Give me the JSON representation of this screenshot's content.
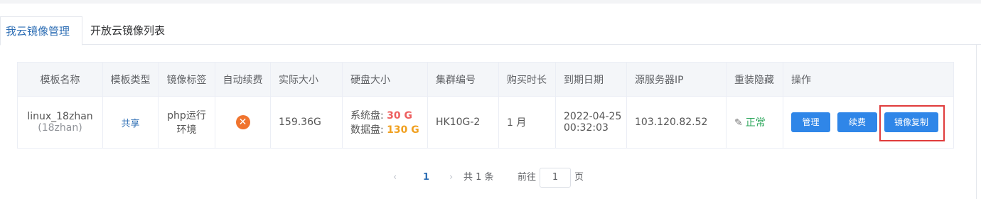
{
  "tabs": [
    {
      "label": "我云镜像管理",
      "active": true
    },
    {
      "label": "开放云镜像列表",
      "active": false
    }
  ],
  "table": {
    "headers": [
      "模板名称",
      "模板类型",
      "镜像标签",
      "自动续费",
      "实际大小",
      "硬盘大小",
      "集群编号",
      "购买时长",
      "到期日期",
      "源服务器IP",
      "重装隐藏",
      "操作"
    ],
    "row": {
      "name": "linux_18zhan",
      "name_sub": "(18zhan)",
      "type": "共享",
      "tag_line1": "php运行",
      "tag_line2": "环境",
      "auto_renew_icon": "x-icon",
      "actual_size": "159.36G",
      "sys_disk_label": "系统盘:",
      "sys_disk_value": "30 G",
      "data_disk_label": "数据盘:",
      "data_disk_value": "130 G",
      "cluster": "HK10G-2",
      "duration": "1 月",
      "expire_date": "2022-04-25",
      "expire_time": "00:32:03",
      "source_ip": "103.120.82.52",
      "reinstall_status": "正常",
      "actions": {
        "manage": "管理",
        "renew": "续费",
        "copy": "镜像复制"
      }
    }
  },
  "pagination": {
    "prev": "‹",
    "current": "1",
    "next": "›",
    "total": "共 1 条",
    "goto_label": "前往",
    "goto_value": "1",
    "unit": "页"
  },
  "colors": {
    "accent": "#2f86e8",
    "highlight": "#e03c3c",
    "status_ok": "#2aa65a"
  }
}
